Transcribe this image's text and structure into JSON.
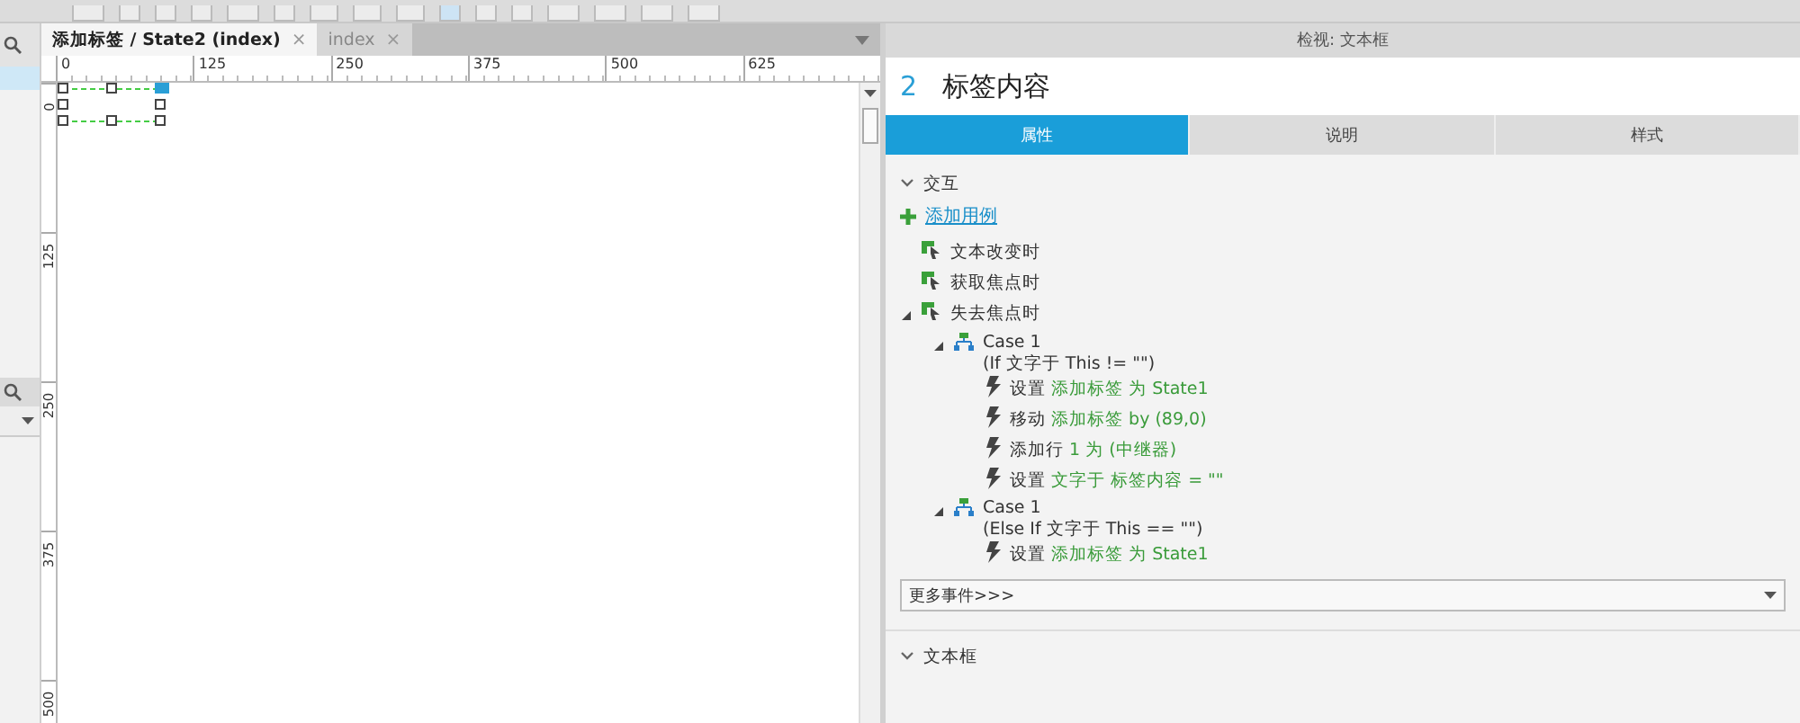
{
  "editor_tabs": [
    {
      "label": "添加标签 / State2 (index)",
      "selected": true,
      "close": "×"
    },
    {
      "label": "index",
      "selected": false,
      "close": "×"
    }
  ],
  "ruler": {
    "x_labels": [
      "0",
      "125",
      "250",
      "375",
      "500",
      "625"
    ],
    "y_labels": [
      "0",
      "125",
      "250",
      "375",
      "500"
    ]
  },
  "inspector": {
    "title": "检视: 文本框",
    "number": "2",
    "name": "标签内容",
    "tabs": [
      {
        "label": "属性",
        "selected": true
      },
      {
        "label": "说明",
        "selected": false
      },
      {
        "label": "样式",
        "selected": false
      }
    ],
    "interaction": {
      "heading": "交互",
      "expanded": true,
      "add_case": "添加用例",
      "events": [
        {
          "label": "文本改变时"
        },
        {
          "label": "获取焦点时"
        },
        {
          "label": "失去焦点时",
          "expanded": true,
          "cases": [
            {
              "label": "Case 1",
              "condition": "(If 文字于 This != \"\")",
              "expanded": true,
              "actions": [
                {
                  "verb": "设置",
                  "detail": "添加标签 为 State1"
                },
                {
                  "verb": "移动",
                  "detail": "添加标签 by (89,0)"
                },
                {
                  "verb": "添加行",
                  "detail": "1 为 (中继器)"
                },
                {
                  "verb": "设置",
                  "detail": "文字于 标签内容 = \"\""
                }
              ]
            },
            {
              "label": "Case 1",
              "condition": "(Else If 文字于 This == \"\")",
              "expanded": true,
              "actions": [
                {
                  "verb": "设置",
                  "detail": "添加标签 为 State1"
                }
              ]
            }
          ]
        }
      ],
      "more_events": "更多事件>>>"
    },
    "textbox_section": {
      "heading": "文本框",
      "expanded": true
    }
  }
}
